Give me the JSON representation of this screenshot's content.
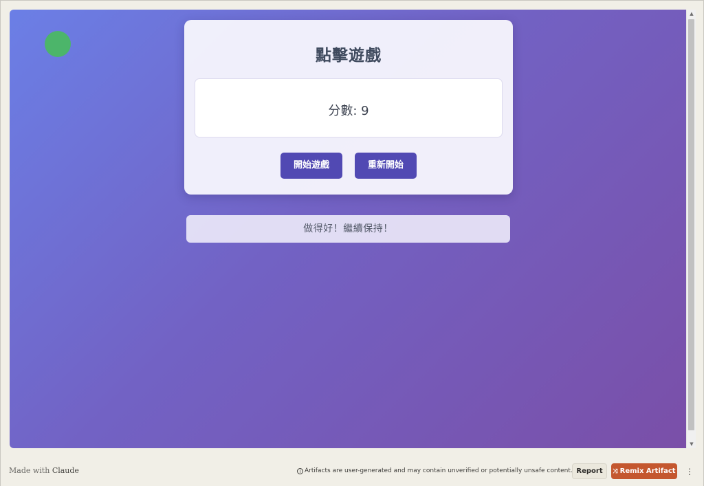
{
  "game": {
    "title": "點擊遊戲",
    "score_label": "分數:",
    "score_value": "9",
    "start_label": "開始遊戲",
    "restart_label": "重新開始",
    "message": "做得好！繼續保持！"
  },
  "colors": {
    "target": "#4cb56a",
    "button": "#5149b3",
    "gradient_start": "#6b7fe6",
    "gradient_end": "#7a4fa8"
  },
  "footer": {
    "made_with_prefix": "Made with",
    "made_with_brand": "Claude",
    "notice_icon": "ⓘ",
    "notice": "Artifacts are user-generated and may contain unverified or potentially unsafe content.",
    "report_label": "Report",
    "remix_icon": "⤨",
    "remix_label": "Remix Artifact",
    "more_icon": "⋮"
  },
  "scrollbar": {
    "up_icon": "▲",
    "down_icon": "▼"
  }
}
